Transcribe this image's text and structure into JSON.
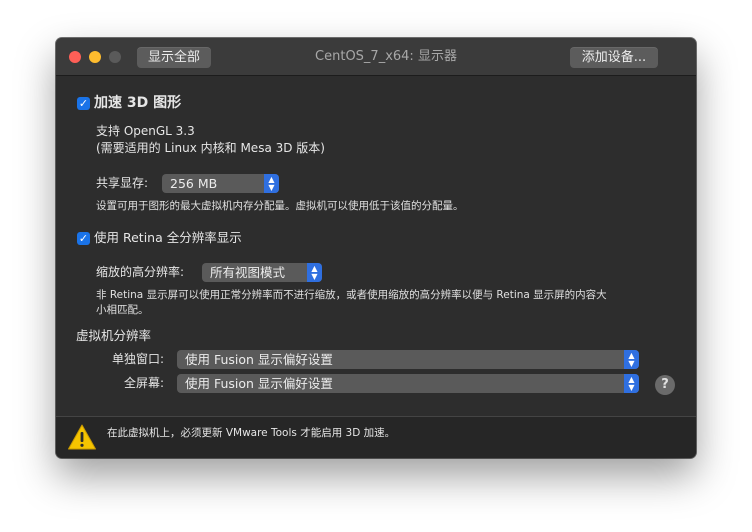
{
  "window": {
    "title": "CentOS_7_x64: 显示器",
    "show_all_label": "显示全部",
    "add_device_label": "添加设备..."
  },
  "accel3d": {
    "label": "加速 3D 图形",
    "checked": true,
    "support_line": "支持 OpenGL 3.3",
    "requirement_line": "(需要适用的 Linux 内核和 Mesa 3D 版本)",
    "shared_mem_label": "共享显存:",
    "shared_mem_value": "256 MB",
    "shared_mem_desc": "设置可用于图形的最大虚拟机内存分配量。虚拟机可以使用低于该值的分配量。"
  },
  "retina": {
    "label": "使用 Retina 全分辨率显示",
    "checked": true,
    "scaled_label": "缩放的高分辨率:",
    "scaled_value": "所有视图模式",
    "desc_line1": "非 Retina 显示屏可以使用正常分辨率而不进行缩放，或者使用缩放的高分辨率以便与 Retina 显示屏的内容大",
    "desc_line2": "小相匹配。"
  },
  "resolution": {
    "section_title": "虚拟机分辨率",
    "single_window_label": "单独窗口:",
    "single_window_value": "使用 Fusion 显示偏好设置",
    "fullscreen_label": "全屏幕:",
    "fullscreen_value": "使用 Fusion 显示偏好设置"
  },
  "help_label": "?",
  "footer": {
    "warning_text": "在此虚拟机上，必须更新 VMware Tools 才能启用 3D 加速。"
  },
  "colors": {
    "accent": "#2f6fe0",
    "window_bg": "#2d2d2d",
    "close": "#fe5f57",
    "minimize": "#febc2e",
    "warning": "#f5c400"
  },
  "icons": {
    "checkbox": "checkmark-icon",
    "popup": "updown-arrows-icon",
    "warning": "warning-triangle-icon"
  }
}
